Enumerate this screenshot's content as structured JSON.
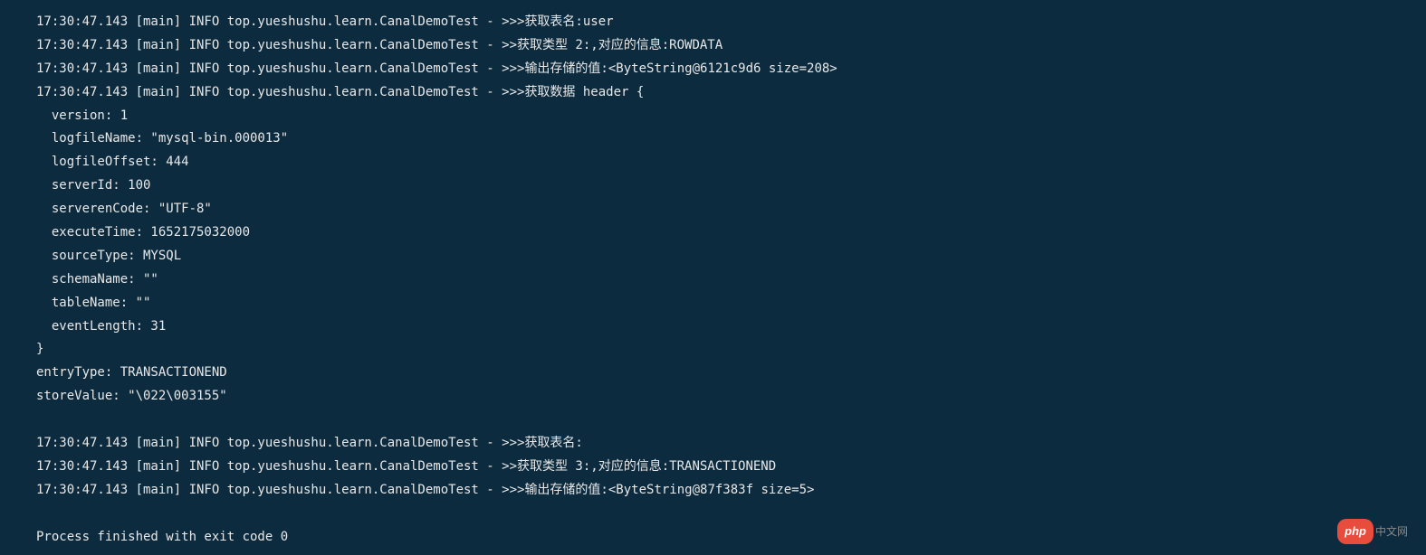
{
  "lines": [
    "17:30:47.143 [main] INFO top.yueshushu.learn.CanalDemoTest - >>>获取表名:user",
    "17:30:47.143 [main] INFO top.yueshushu.learn.CanalDemoTest - >>获取类型 2:,对应的信息:ROWDATA",
    "17:30:47.143 [main] INFO top.yueshushu.learn.CanalDemoTest - >>>输出存储的值:<ByteString@6121c9d6 size=208>",
    "17:30:47.143 [main] INFO top.yueshushu.learn.CanalDemoTest - >>>获取数据 header {",
    "  version: 1",
    "  logfileName: \"mysql-bin.000013\"",
    "  logfileOffset: 444",
    "  serverId: 100",
    "  serverenCode: \"UTF-8\"",
    "  executeTime: 1652175032000",
    "  sourceType: MYSQL",
    "  schemaName: \"\"",
    "  tableName: \"\"",
    "  eventLength: 31",
    "}",
    "entryType: TRANSACTIONEND",
    "storeValue: \"\\022\\003155\"",
    "",
    "17:30:47.143 [main] INFO top.yueshushu.learn.CanalDemoTest - >>>获取表名:",
    "17:30:47.143 [main] INFO top.yueshushu.learn.CanalDemoTest - >>获取类型 3:,对应的信息:TRANSACTIONEND",
    "17:30:47.143 [main] INFO top.yueshushu.learn.CanalDemoTest - >>>输出存储的值:<ByteString@87f383f size=5>",
    "",
    "Process finished with exit code 0"
  ],
  "watermark": {
    "badge": "php",
    "text": "中文网"
  }
}
